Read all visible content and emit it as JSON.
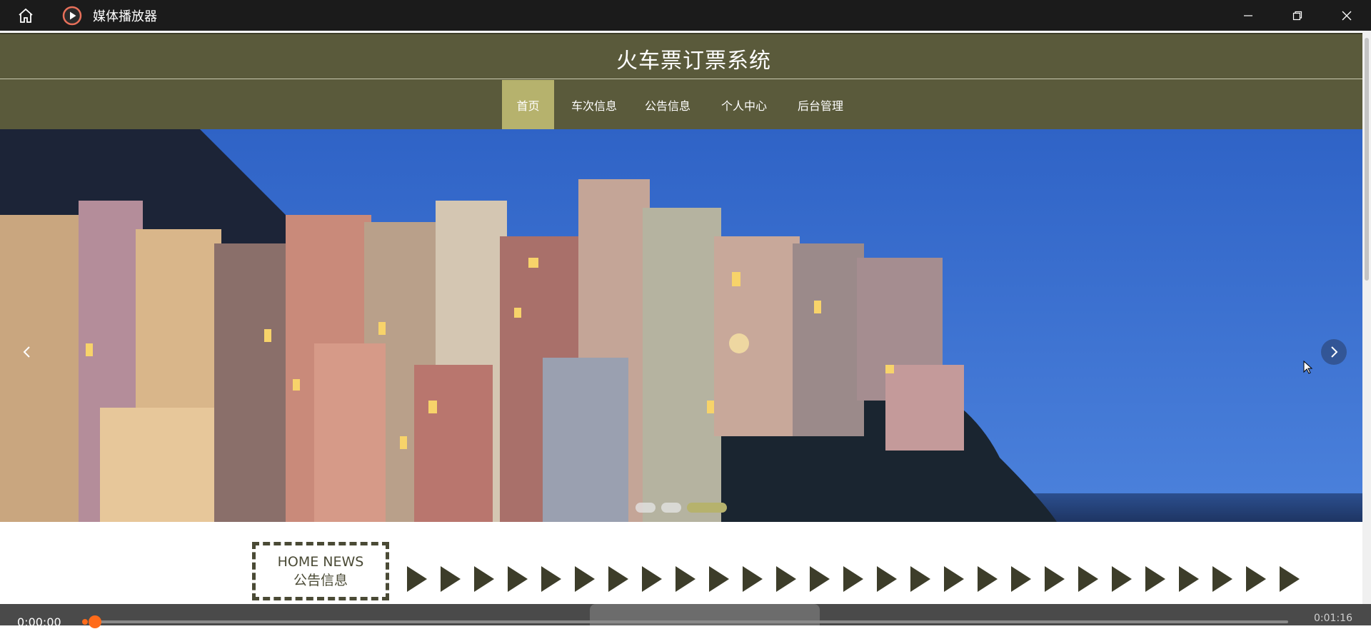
{
  "window": {
    "title": "媒体播放器",
    "icons": {
      "home": "home-icon",
      "app": "play-circle-icon",
      "minimize": "minimize-icon",
      "restore": "restore-icon",
      "close": "close-icon"
    }
  },
  "site": {
    "title": "火车票订票系统",
    "nav": [
      {
        "label": "首页",
        "active": true
      },
      {
        "label": "车次信息",
        "active": false
      },
      {
        "label": "公告信息",
        "active": false
      },
      {
        "label": "个人中心",
        "active": false
      },
      {
        "label": "后台管理",
        "active": false
      }
    ],
    "colors": {
      "header_bg": "#5a5a3b",
      "nav_active": "#b6b26d",
      "sky": "#3a6fd1"
    }
  },
  "carousel": {
    "slide_count": 3,
    "active_index": 2,
    "icons": {
      "prev": "chevron-left-icon",
      "next": "chevron-right-icon"
    }
  },
  "news": {
    "heading_en": "HOME NEWS",
    "heading_cn": "公告信息",
    "icon": "play-arrow-icon"
  },
  "media": {
    "current_time": "0:00:00",
    "end_time": "0:01:16",
    "progress": 0.0,
    "accent": "#ff6b1a"
  }
}
